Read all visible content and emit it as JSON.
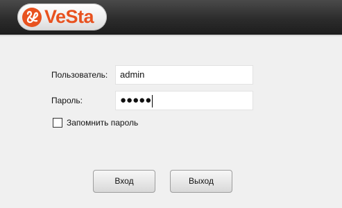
{
  "header": {
    "logo_text": "VeSta"
  },
  "login_form": {
    "username_label": "Пользователь:",
    "username_value": "admin",
    "password_label": "Пароль:",
    "password_value": "●●●●●",
    "remember_label": "Запомнить пароль",
    "remember_checked": false
  },
  "buttons": {
    "login_label": "Вход",
    "exit_label": "Выход"
  },
  "colors": {
    "brand": "#e8521f",
    "header": "#2c2c2c",
    "background": "#f0f0f0"
  }
}
